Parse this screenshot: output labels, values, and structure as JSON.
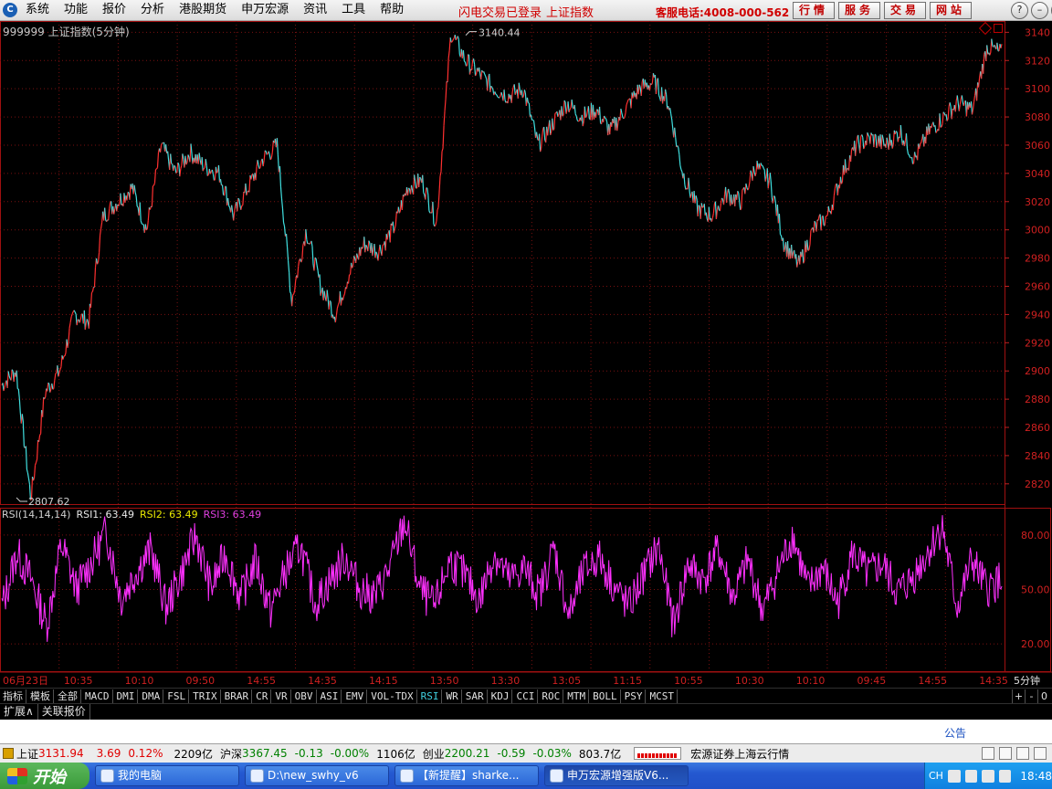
{
  "menu": {
    "logo_glyph": "C",
    "items": [
      "系统",
      "功能",
      "报价",
      "分析",
      "港股期货",
      "申万宏源",
      "资讯",
      "工具",
      "帮助"
    ],
    "login_status": "闪电交易已登录",
    "index_name": "上证指数",
    "service_phone": "客服电话:4008-000-562",
    "top_buttons": [
      "行情",
      "服务",
      "交易",
      "网站"
    ],
    "window_controls": [
      "?",
      "–",
      "▭",
      "✕"
    ]
  },
  "chart": {
    "title": "999999 上证指数(5分钟)",
    "high_label": "3140.44",
    "low_label": "2807.62",
    "rsi_legend": {
      "name": "RSI(14,14,14)",
      "rsi1": "RSI1: 63.49",
      "rsi2": "RSI2: 63.49",
      "rsi3": "RSI3: 63.49"
    },
    "period_label": "5分钟"
  },
  "chart_data": [
    {
      "type": "line",
      "title": "999999 上证指数(5分钟)",
      "series": [
        {
          "name": "上证指数",
          "values": [
            2890,
            2900,
            2810,
            2885,
            2900,
            2940,
            2935,
            3010,
            3020,
            3030,
            3000,
            3060,
            3040,
            3055,
            3045,
            3040,
            3010,
            3030,
            3050,
            3060,
            2950,
            3000,
            2960,
            2940,
            2970,
            2990,
            2985,
            3000,
            3030,
            3035,
            3005,
            3140,
            3120,
            3110,
            3100,
            3095,
            3100,
            3060,
            3075,
            3090,
            3080,
            3085,
            3070,
            3085,
            3100,
            3105,
            3090,
            3040,
            3015,
            3010,
            3025,
            3020,
            3045,
            3035,
            2990,
            2975,
            3000,
            3010,
            3040,
            3060,
            3065,
            3060,
            3070,
            3050,
            3070,
            3080,
            3090,
            3085,
            3130,
            3125
          ]
        }
      ],
      "yticks": [
        3140,
        3120,
        3100,
        3080,
        3060,
        3040,
        3020,
        3000,
        2980,
        2960,
        2940,
        2920,
        2900,
        2880,
        2860,
        2840,
        2820
      ],
      "ylim": [
        2805,
        3148
      ],
      "annotations": [
        "3140.44",
        "2807.62"
      ],
      "grid": true
    },
    {
      "type": "line",
      "title": "RSI(14,14,14)",
      "series": [
        {
          "name": "RSI3",
          "values": [
            40,
            70,
            55,
            30,
            75,
            50,
            65,
            82,
            45,
            60,
            72,
            40,
            58,
            80,
            50,
            70,
            45,
            66,
            38,
            60,
            74,
            42,
            55,
            68,
            50,
            46,
            62,
            88,
            50,
            40,
            66,
            58,
            44,
            70,
            55,
            62,
            47,
            73,
            35,
            60,
            68,
            52,
            40,
            58,
            74,
            30,
            64,
            55,
            72,
            45,
            66,
            38,
            60,
            80,
            50,
            62,
            42,
            70,
            58,
            64,
            48,
            56,
            70,
            85,
            40,
            66,
            50,
            56
          ]
        }
      ],
      "yticks": [
        80.0,
        50.0,
        20.0
      ],
      "ylim": [
        5,
        95
      ],
      "grid": true
    }
  ],
  "xticks": [
    "06月23日",
    "10:35",
    "10:10",
    "09:50",
    "14:55",
    "14:35",
    "14:15",
    "13:50",
    "13:30",
    "13:05",
    "11:15",
    "10:55",
    "10:30",
    "10:10",
    "09:45",
    "14:55",
    "14:35"
  ],
  "tabs": [
    "指标",
    "模板",
    "全部",
    "MACD",
    "DMI",
    "DMA",
    "FSL",
    "TRIX",
    "BRAR",
    "CR",
    "VR",
    "OBV",
    "ASI",
    "EMV",
    "VOL-TDX",
    "RSI",
    "WR",
    "SAR",
    "KDJ",
    "CCI",
    "ROC",
    "MTM",
    "BOLL",
    "PSY",
    "MCST"
  ],
  "tab_tools": [
    "+",
    "-",
    "0"
  ],
  "ext": [
    "扩展∧",
    "关联报价"
  ],
  "notice": "公告",
  "status": {
    "sh_label": "上证",
    "sh_value": "3131.94",
    "sh_change": "3.69",
    "sh_pct": "0.12%",
    "sh_amount": "2209亿",
    "hs_label": "沪深",
    "hs_value": "3367.45",
    "hs_change": "-0.13",
    "hs_pct": "-0.00%",
    "hs_amount": "1106亿",
    "cy_label": "创业",
    "cy_value": "2200.21",
    "cy_change": "-0.59",
    "cy_pct": "-0.03%",
    "cy_amount": "803.7亿",
    "broker": "宏源证券上海云行情"
  },
  "taskbar": {
    "start": "开始",
    "tasks": [
      "我的电脑",
      "D:\\new_swhy_v6",
      "【新提醒】sharke...",
      "申万宏源增强版V6..."
    ],
    "lang": "CH",
    "clock": "18:48"
  },
  "colors": {
    "up": "#ff3030",
    "down": "#40e0e0",
    "rsi": "#ff30ff",
    "grid": "#7a1010"
  }
}
